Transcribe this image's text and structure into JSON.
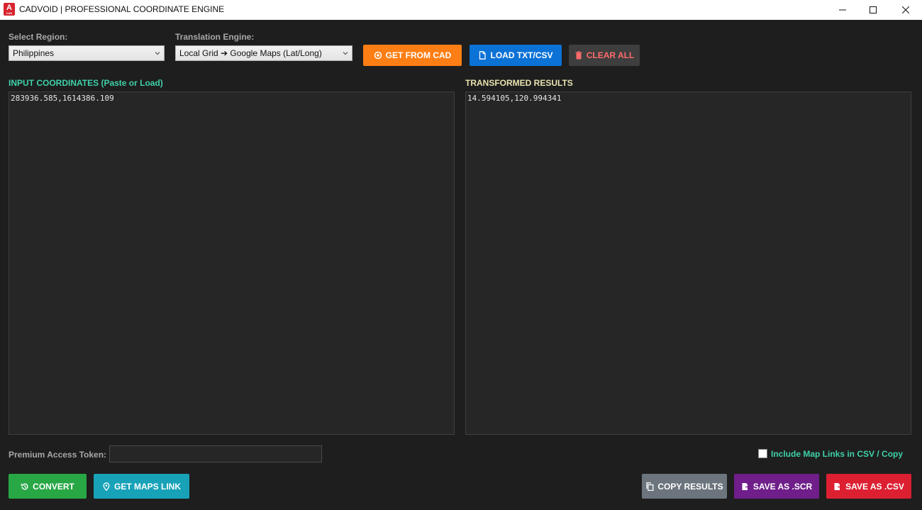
{
  "window": {
    "title": "CADVOID | PROFESSIONAL COORDINATE ENGINE",
    "icon_letter": "A",
    "icon_sub": "CAD"
  },
  "controls": {
    "region_label": "Select Region:",
    "region_value": "Philippines",
    "engine_label": "Translation Engine:",
    "engine_value": "Local Grid ➔ Google Maps (Lat/Long)"
  },
  "buttons": {
    "get_from_cad": "GET FROM CAD",
    "load_txt_csv": "LOAD TXT/CSV",
    "clear_all": "CLEAR ALL",
    "convert": "CONVERT",
    "get_maps_link": "GET MAPS LINK",
    "copy_results": "COPY RESULTS",
    "save_scr": "SAVE AS .SCR",
    "save_csv": "SAVE AS .CSV"
  },
  "input": {
    "title": "INPUT COORDINATES (Paste or Load)",
    "value": "283936.585,1614386.109"
  },
  "output": {
    "title": "TRANSFORMED RESULTS",
    "value": "14.594105,120.994341"
  },
  "token": {
    "label": "Premium Access Token:",
    "value": ""
  },
  "include_links": {
    "label": "Include Map Links in CSV / Copy",
    "checked": false
  },
  "colors": {
    "orange": "#fd7e14",
    "blue": "#0d6efd",
    "gray_dark": "#3e3e3e",
    "clear_text": "#ff6b6b",
    "green": "#28a745",
    "teal": "#17a2b8",
    "gray": "#6c757d",
    "purple": "#6f1e8a",
    "red": "#dc1f31",
    "input_title": "#3fd0a8",
    "output_title": "#e8e2b0"
  }
}
